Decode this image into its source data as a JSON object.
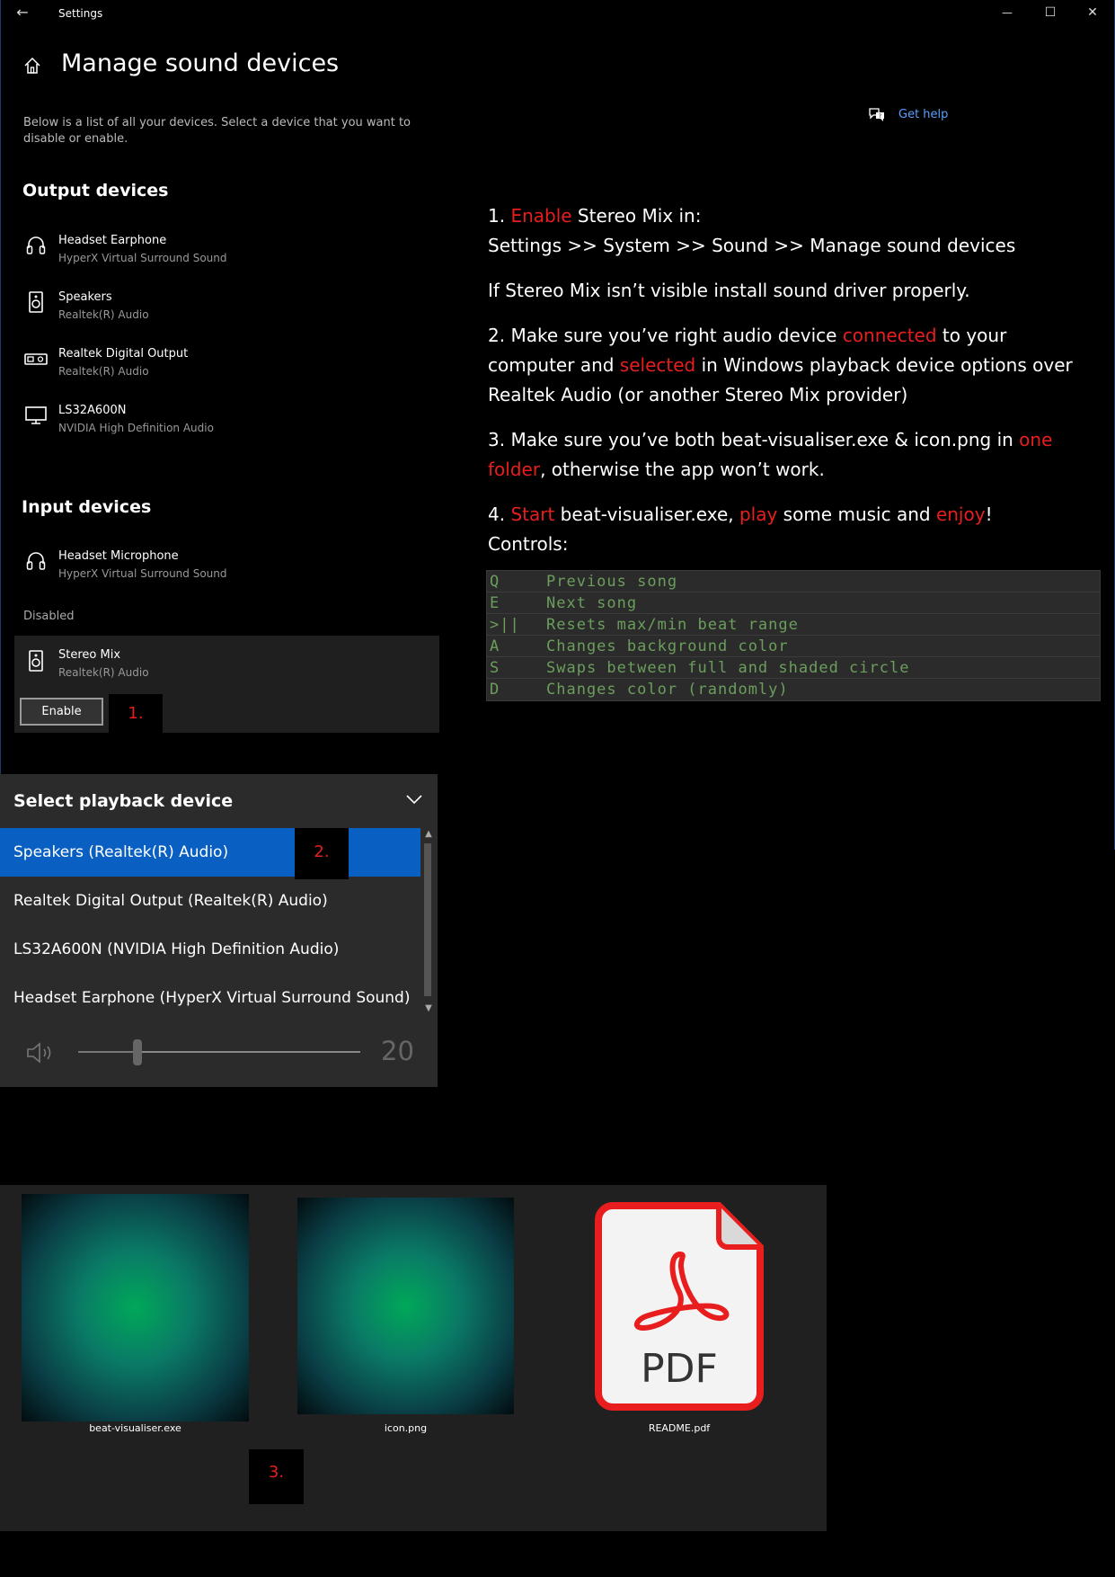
{
  "window": {
    "title": "Settings",
    "back_glyph": "←",
    "minimize_glyph": "—",
    "maximize_glyph": "☐",
    "close_glyph": "✕"
  },
  "page": {
    "title": "Manage sound devices",
    "description": "Below is a list of all your devices. Select a device that you want to disable or enable.",
    "get_help": "Get help"
  },
  "output_devices": {
    "heading": "Output devices",
    "items": [
      {
        "name": "Headset Earphone",
        "sub": "HyperX Virtual Surround Sound",
        "icon": "headset-icon"
      },
      {
        "name": "Speakers",
        "sub": "Realtek(R) Audio",
        "icon": "speaker-icon"
      },
      {
        "name": "Realtek Digital Output",
        "sub": "Realtek(R) Audio",
        "icon": "digital-output-icon"
      },
      {
        "name": "LS32A600N",
        "sub": "NVIDIA High Definition Audio",
        "icon": "monitor-icon"
      }
    ]
  },
  "input_devices": {
    "heading": "Input devices",
    "items": [
      {
        "name": "Headset Microphone",
        "sub": "HyperX Virtual Surround Sound",
        "icon": "headset-icon"
      }
    ]
  },
  "disabled": {
    "heading": "Disabled",
    "item": {
      "name": "Stereo Mix",
      "sub": "Realtek(R) Audio",
      "icon": "speaker-icon"
    },
    "button": "Enable",
    "step": "1."
  },
  "instructions": {
    "s1a": "1. ",
    "s1_red": "Enable",
    "s1b": " Stereo Mix in:",
    "s1_path": "Settings >> System >> Sound >> Manage sound devices",
    "s_note": "If Stereo Mix isn’t visible install sound driver properly.",
    "s2a": "2. Make sure you’ve right audio device ",
    "s2_red1": "connected",
    "s2b": " to your computer and ",
    "s2_red2": "selected",
    "s2c": " in Windows playback device options over Realtek Audio (or another Stereo Mix provider)",
    "s3a": "3. Make sure you’ve both beat-visualiser.exe & icon.png in ",
    "s3_red": "one folder",
    "s3b": ", otherwise the app won’t work.",
    "s4a": "4. ",
    "s4_red1": "Start",
    "s4b": " beat-visualiser.exe, ",
    "s4_red2": "play",
    "s4c": " some music and ",
    "s4_red3": "enjoy",
    "s4d": "!",
    "controls_label": "Controls:"
  },
  "controls": [
    {
      "key": "Q",
      "desc": "Previous song"
    },
    {
      "key": "E",
      "desc": "Next song"
    },
    {
      "key": ">||",
      "desc": "Resets max/min beat range"
    },
    {
      "key": "A",
      "desc": "Changes background color"
    },
    {
      "key": "S",
      "desc": "Swaps between full and shaded circle"
    },
    {
      "key": "D",
      "desc": "Changes color (randomly)"
    }
  ],
  "playback": {
    "title": "Select playback device",
    "items": [
      "Speakers (Realtek(R) Audio)",
      "Realtek Digital Output (Realtek(R) Audio)",
      "LS32A600N (NVIDIA High Definition Audio)",
      "Headset Earphone (HyperX Virtual Surround Sound)"
    ],
    "selected_index": 0,
    "volume": "20",
    "volume_fraction": 0.2,
    "step": "2."
  },
  "files": {
    "items": [
      {
        "name": "beat-visualiser.exe"
      },
      {
        "name": "icon.png"
      },
      {
        "name": "README.pdf",
        "badge": "PDF"
      }
    ],
    "step": "3."
  },
  "colors": {
    "accent_red": "#e81e1e",
    "selection_blue": "#0a60c2",
    "link_blue": "#5aa0ff",
    "code_green": "#6b9e5c"
  }
}
